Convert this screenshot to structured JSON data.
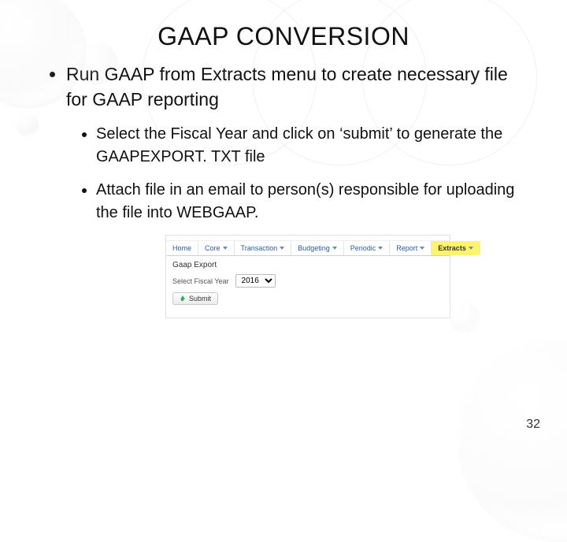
{
  "title": "GAAP CONVERSION",
  "bullets": {
    "lvl1_1": "Run GAAP from Extracts menu to create necessary file for GAAP reporting",
    "lvl2_1": "Select the Fiscal Year and click on ‘submit’ to generate the GAAPEXPORT. TXT file",
    "lvl2_2": "Attach file in an email to person(s) responsible for uploading the file into WEBGAAP."
  },
  "app": {
    "breadcrumb": "",
    "tabs": {
      "home": "Home",
      "core": "Core",
      "transaction": "Transaction",
      "budgeting": "Budgeting",
      "periodic": "Periodic",
      "report": "Report",
      "extracts": "Extracts"
    },
    "panel_title": "Gaap Export",
    "fy_label": "Select Fiscal Year",
    "fy_value": "2016",
    "submit_label": "Submit"
  },
  "page_number": "32"
}
